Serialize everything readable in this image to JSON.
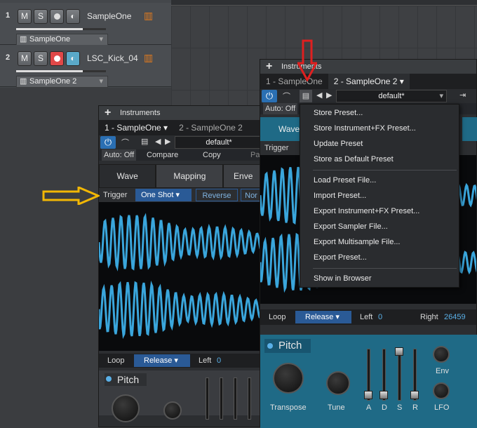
{
  "tracks": [
    {
      "num": "1",
      "m": "M",
      "s": "S",
      "name": "SampleOne",
      "instrument": "SampleOne",
      "record_armed": false,
      "monitor_on": false
    },
    {
      "num": "2",
      "m": "M",
      "s": "S",
      "name": "LSC_Kick_04",
      "instrument": "SampleOne 2",
      "record_armed": true,
      "monitor_on": true
    }
  ],
  "back_window": {
    "title": "Instruments",
    "tabs": [
      "1 - SampleOne",
      "2 - SampleOne 2"
    ],
    "preset": "default*",
    "auto": "Auto: Off",
    "compare": "Compare",
    "copy": "Copy",
    "paste": "Pa",
    "section_tabs": [
      "Wave",
      "Mapping",
      "Enve"
    ],
    "trigger_label": "Trigger",
    "trigger_value": "One Shot",
    "reverse": "Reverse",
    "norm": "Nor",
    "loop_label": "Loop",
    "loop_value": "Release",
    "left_label": "Left",
    "left_value": "0",
    "pitch": "Pitch"
  },
  "front_window": {
    "title": "Instruments",
    "tabs": [
      "1 - SampleOne",
      "2 - SampleOne 2"
    ],
    "preset": "default*",
    "auto": "Auto: Off",
    "section_tab": "Wave",
    "trigger_label": "Trigger",
    "loop_label": "Loop",
    "loop_value": "Release",
    "left_label": "Left",
    "left_value": "0",
    "right_label": "Right",
    "right_value": "26459",
    "pitch": "Pitch",
    "knob_labels": [
      "Transpose",
      "Tune"
    ],
    "adsr": [
      "A",
      "D",
      "S",
      "R"
    ],
    "env": "Env",
    "lfo": "LFO"
  },
  "preset_menu": {
    "items": [
      "Store Preset...",
      "Store Instrument+FX Preset...",
      "Update Preset",
      "Store as Default Preset",
      "Load Preset File...",
      "Import Preset...",
      "Export Instrument+FX Preset...",
      "Export Sampler File...",
      "Export Multisample File...",
      "Export Preset...",
      "Show in Browser"
    ]
  },
  "colors": {
    "accent": "#2a6fb3",
    "waveform": "#3aa6dc",
    "record": "#e04848",
    "monitor": "#5aa9c9",
    "annotation_red": "#e02020",
    "annotation_yellow": "#f2b705",
    "panel_teal": "#1f6a86"
  }
}
